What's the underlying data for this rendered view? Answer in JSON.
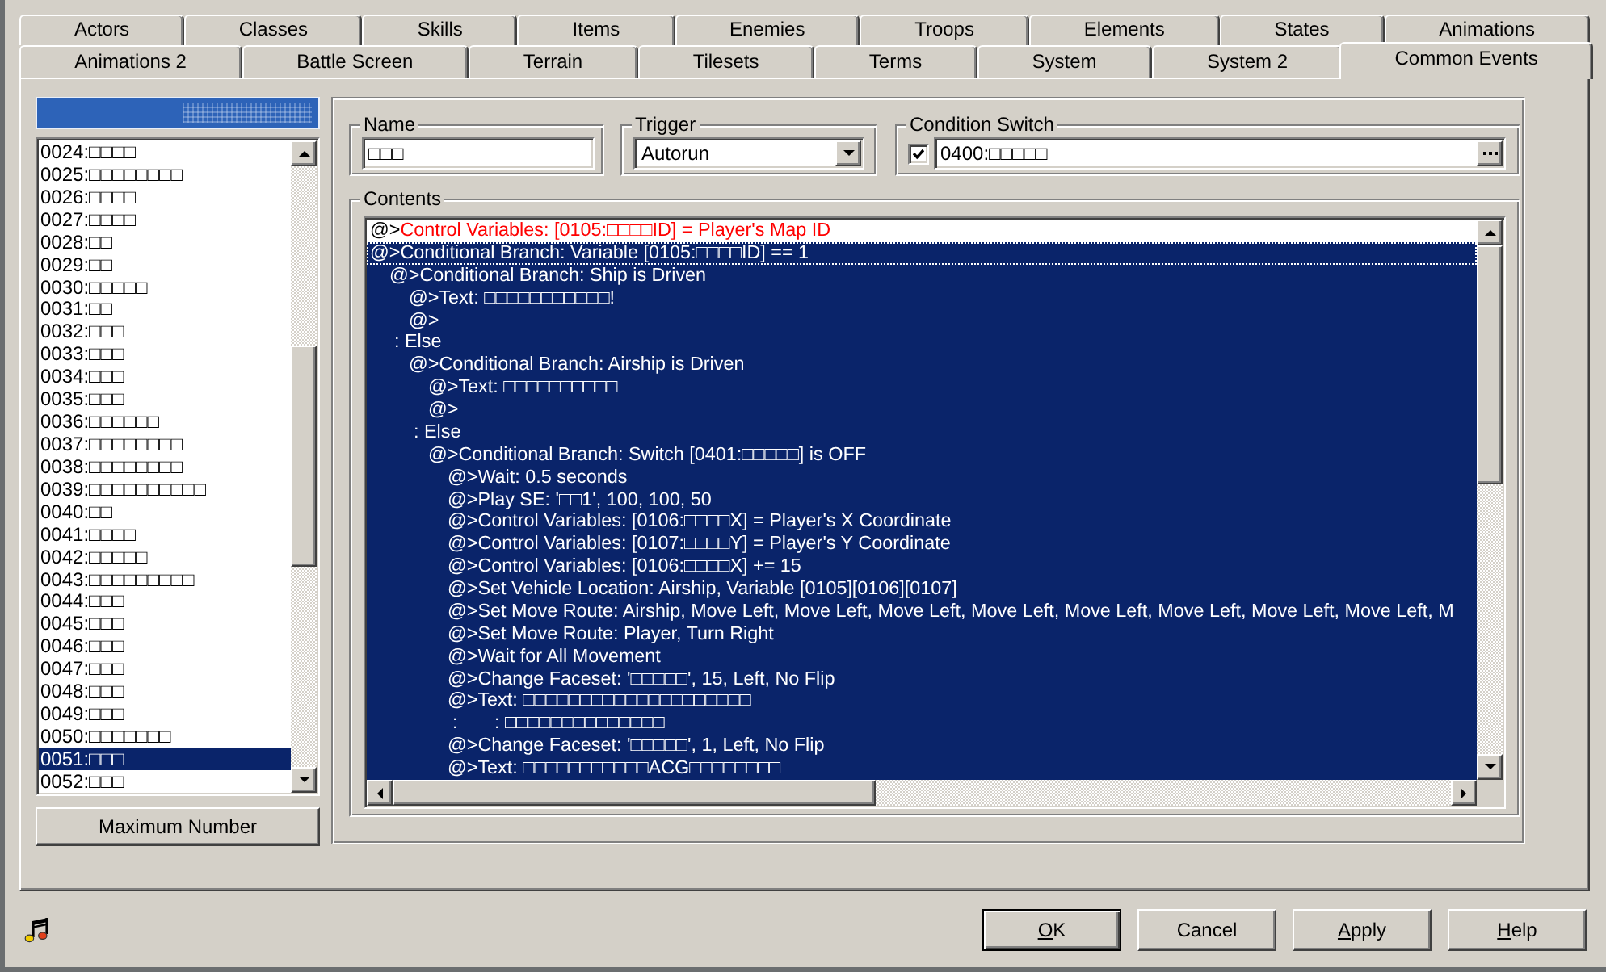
{
  "tab_rows": [
    [
      {
        "label": "Actors",
        "selected": false
      },
      {
        "label": "Classes",
        "selected": false
      },
      {
        "label": "Skills",
        "selected": false
      },
      {
        "label": "Items",
        "selected": false
      },
      {
        "label": "Enemies",
        "selected": false
      },
      {
        "label": "Troops",
        "selected": false
      },
      {
        "label": "Elements",
        "selected": false
      },
      {
        "label": "States",
        "selected": false
      },
      {
        "label": "Animations",
        "selected": false
      }
    ],
    [
      {
        "label": "Animations 2",
        "selected": false
      },
      {
        "label": "Battle Screen",
        "selected": false
      },
      {
        "label": "Terrain",
        "selected": false
      },
      {
        "label": "Tilesets",
        "selected": false
      },
      {
        "label": "Terms",
        "selected": false
      },
      {
        "label": "System",
        "selected": false
      },
      {
        "label": "System 2",
        "selected": false
      },
      {
        "label": "Common Events",
        "selected": true
      }
    ]
  ],
  "event_list": {
    "items": [
      {
        "label": "0024:□□□□",
        "selected": false
      },
      {
        "label": "0025:□□□□□□□□",
        "selected": false
      },
      {
        "label": "0026:□□□□",
        "selected": false
      },
      {
        "label": "0027:□□□□",
        "selected": false
      },
      {
        "label": "0028:□□",
        "selected": false
      },
      {
        "label": "0029:□□",
        "selected": false
      },
      {
        "label": "0030:□□□□□",
        "selected": false
      },
      {
        "label": "0031:□□",
        "selected": false
      },
      {
        "label": "0032:□□□",
        "selected": false
      },
      {
        "label": "0033:□□□",
        "selected": false
      },
      {
        "label": "0034:□□□",
        "selected": false
      },
      {
        "label": "0035:□□□",
        "selected": false
      },
      {
        "label": "0036:□□□□□□",
        "selected": false
      },
      {
        "label": "0037:□□□□□□□□",
        "selected": false
      },
      {
        "label": "0038:□□□□□□□□",
        "selected": false
      },
      {
        "label": "0039:□□□□□□□□□□",
        "selected": false
      },
      {
        "label": "0040:□□",
        "selected": false
      },
      {
        "label": "0041:□□□□",
        "selected": false
      },
      {
        "label": "0042:□□□□□",
        "selected": false
      },
      {
        "label": "0043:□□□□□□□□□",
        "selected": false
      },
      {
        "label": "0044:□□□",
        "selected": false
      },
      {
        "label": "0045:□□□",
        "selected": false
      },
      {
        "label": "0046:□□□",
        "selected": false
      },
      {
        "label": "0047:□□□",
        "selected": false
      },
      {
        "label": "0048:□□□",
        "selected": false
      },
      {
        "label": "0049:□□□",
        "selected": false
      },
      {
        "label": "0050:□□□□□□□",
        "selected": false
      },
      {
        "label": "0051:□□□",
        "selected": true
      },
      {
        "label": "0052:□□□",
        "selected": false
      }
    ],
    "button": "Maximum Number"
  },
  "name": {
    "label": "Name",
    "value": "□□□"
  },
  "trigger": {
    "label": "Trigger",
    "value": "Autorun"
  },
  "condition_switch": {
    "label": "Condition Switch",
    "checked": true,
    "value": "0400:□□□□□"
  },
  "contents": {
    "label": "Contents",
    "commands": [
      {
        "prefix": "@>",
        "text": "Control Variables: [0105:□□□□ID] = Player's Map ID",
        "color": "#ff0000",
        "selected": false,
        "focused": false
      },
      {
        "prefix": "@>",
        "text": "Conditional Branch: Variable [0105:□□□□ID] == 1",
        "selected": true,
        "focused": true,
        "children": [
          {
            "prefix": "@>",
            "text": "Conditional Branch: Ship is Driven",
            "selected": true,
            "focused": false,
            "children": [
              {
                "prefix": "@>",
                "text": "Text: □□□□□□□□□□□!",
                "selected": true,
                "focused": false
              },
              {
                "prefix": "@>",
                "selected": true,
                "focused": false
              }
            ]
          },
          {
            "text": ": Else",
            "selected": true,
            "focused": false,
            "children": [
              {
                "prefix": "@>",
                "text": "Conditional Branch: Airship is Driven",
                "selected": true,
                "focused": false,
                "children": [
                  {
                    "prefix": "@>",
                    "text": "Text: □□□□□□□□□□",
                    "selected": true,
                    "focused": false
                  },
                  {
                    "prefix": "@>",
                    "selected": true,
                    "focused": false
                  }
                ]
              },
              {
                "text": ": Else",
                "selected": true,
                "focused": false,
                "children": [
                  {
                    "prefix": "@>",
                    "text": "Conditional Branch: Switch [0401:□□□□□] is OFF",
                    "selected": true,
                    "focused": false,
                    "children": [
                      {
                        "prefix": "@>",
                        "text": "Wait: 0.5 seconds",
                        "selected": true,
                        "focused": false
                      },
                      {
                        "prefix": "@>",
                        "text": "Play SE: '□□1', 100, 100, 50",
                        "selected": true,
                        "focused": false
                      },
                      {
                        "prefix": "@>",
                        "text": "Control Variables: [0106:□□□□X] = Player's X Coordinate",
                        "selected": true,
                        "focused": false
                      },
                      {
                        "prefix": "@>",
                        "text": "Control Variables: [0107:□□□□Y] = Player's Y Coordinate",
                        "selected": true,
                        "focused": false
                      },
                      {
                        "prefix": "@>",
                        "text": "Control Variables: [0106:□□□□X] += 15",
                        "selected": true,
                        "focused": false
                      },
                      {
                        "prefix": "@>",
                        "text": "Set Vehicle Location: Airship, Variable [0105][0106][0107]",
                        "selected": true,
                        "focused": false
                      },
                      {
                        "prefix": "@>",
                        "text": "Set Move Route: Airship, Move Left, Move Left, Move Left, Move Left, Move Left, Move Left, Move Left, Move Left, M",
                        "selected": true,
                        "focused": false
                      },
                      {
                        "prefix": "@>",
                        "text": "Set Move Route: Player, Turn Right",
                        "selected": true,
                        "focused": false
                      },
                      {
                        "prefix": "@>",
                        "text": "Wait for All Movement",
                        "selected": true,
                        "focused": false
                      },
                      {
                        "prefix": "@>",
                        "text": "Change Faceset: '□□□□□', 15, Left, No Flip",
                        "selected": true,
                        "focused": false
                      },
                      {
                        "prefix": "@>",
                        "text": "Text: □□□□□□□□□□□□□□□□□□□□",
                        "selected": true,
                        "focused": false
                      },
                      {
                        "text": ":       : □□□□□□□□□□□□□□",
                        "selected": true,
                        "focused": false
                      },
                      {
                        "prefix": "@>",
                        "text": "Change Faceset: '□□□□□', 1, Left, No Flip",
                        "selected": true,
                        "focused": false
                      },
                      {
                        "prefix": "@>",
                        "text": "Text: □□□□□□□□□□□ACG□□□□□□□□",
                        "selected": true,
                        "focused": false
                      }
                    ]
                  }
                ]
              }
            ]
          }
        ]
      }
    ]
  },
  "buttons": [
    {
      "label": "OK",
      "default": true,
      "mnemonic": true
    },
    {
      "label": "Cancel",
      "default": false,
      "mnemonic": false
    },
    {
      "label": "Apply",
      "default": false,
      "mnemonic": true
    },
    {
      "label": "Help",
      "default": false,
      "mnemonic": true
    }
  ]
}
